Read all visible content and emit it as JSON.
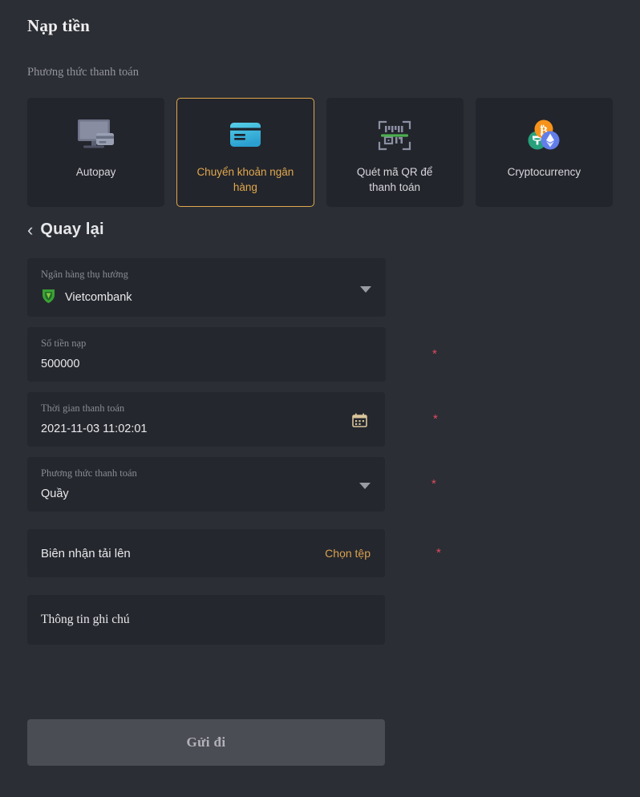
{
  "header": {
    "title": "Nạp tiền",
    "section_label": "Phương thức thanh toán"
  },
  "payment_methods": [
    {
      "label": "Autopay",
      "icon": "monitor-card-icon",
      "selected": false
    },
    {
      "label": "Chuyển khoản ngân hàng",
      "icon": "bank-card-icon",
      "selected": true
    },
    {
      "label": "Quét mã QR để thanh toán",
      "icon": "qr-scan-icon",
      "selected": false
    },
    {
      "label": "Cryptocurrency",
      "icon": "crypto-coins-icon",
      "selected": false
    }
  ],
  "back": {
    "label": "Quay lại",
    "chevron": "‹"
  },
  "form": {
    "bank": {
      "label": "Ngân hàng thụ hưởng",
      "value": "Vietcombank",
      "logo": "vietcombank-logo"
    },
    "amount": {
      "label": "Số tiền nạp",
      "value": "500000",
      "required": "*"
    },
    "datetime": {
      "label": "Thời gian thanh toán",
      "value": "2021-11-03 11:02:01",
      "required": "*",
      "icon": "calendar-icon"
    },
    "method": {
      "label": "Phương thức thanh toán",
      "value": "Quầy",
      "required": "*"
    },
    "upload": {
      "label": "Biên nhận tải lên",
      "action": "Chọn tệp",
      "required": "*"
    },
    "note": {
      "label": "Thông tin ghi chú"
    }
  },
  "submit": {
    "label": "Gửi đi"
  },
  "colors": {
    "page_bg": "#2b2e34",
    "card_bg": "#23252c",
    "field_bg": "#25272e",
    "accent_orange": "#e0a84e",
    "required_red": "#e04a5f",
    "submit_bg": "#4b4d55"
  }
}
